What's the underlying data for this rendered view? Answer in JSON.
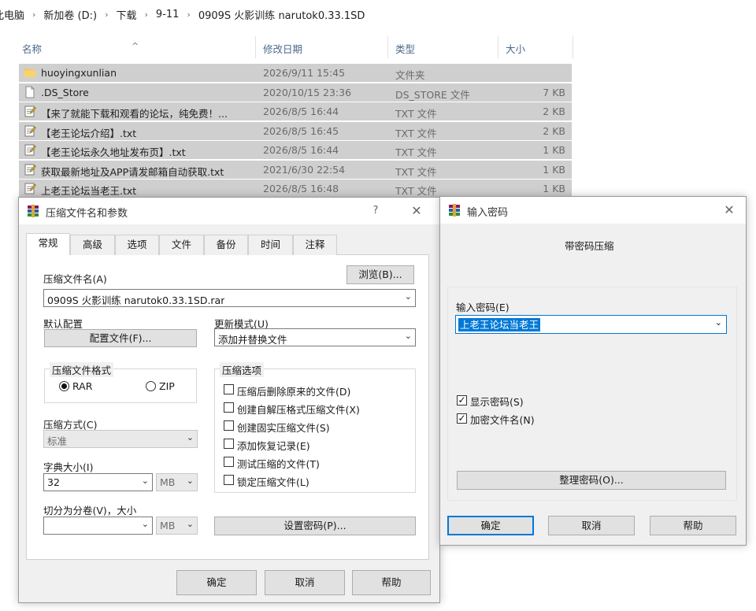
{
  "breadcrumb": [
    "此电脑",
    "新加卷 (D:)",
    "下载",
    "9-11",
    "0909S 火影训练 narutok0.33.1SD"
  ],
  "file_list": {
    "columns": {
      "name": "名称",
      "date": "修改日期",
      "type": "类型",
      "size": "大小"
    },
    "rows": [
      {
        "icon": "folder-icon",
        "name": "huoyingxunlian",
        "date": "2026/9/11 15:45",
        "type": "文件夹",
        "size": ""
      },
      {
        "icon": "file-icon",
        "name": ".DS_Store",
        "date": "2020/10/15 23:36",
        "type": "DS_STORE 文件",
        "size": "7 KB"
      },
      {
        "icon": "text-file-icon",
        "name": "【来了就能下载和观看的论坛，纯免费！...",
        "date": "2026/8/5 16:44",
        "type": "TXT 文件",
        "size": "2 KB"
      },
      {
        "icon": "text-file-icon",
        "name": "【老王论坛介绍】.txt",
        "date": "2026/8/5 16:45",
        "type": "TXT 文件",
        "size": "2 KB"
      },
      {
        "icon": "text-file-icon",
        "name": "【老王论坛永久地址发布页】.txt",
        "date": "2026/8/5 16:44",
        "type": "TXT 文件",
        "size": "1 KB"
      },
      {
        "icon": "text-file-icon",
        "name": "获取最新地址及APP请发邮箱自动获取.txt",
        "date": "2021/6/30 22:54",
        "type": "TXT 文件",
        "size": "1 KB"
      },
      {
        "icon": "text-file-icon",
        "name": "上老王论坛当老王.txt",
        "date": "2026/8/5 16:48",
        "type": "TXT 文件",
        "size": "1 KB"
      }
    ]
  },
  "archive_dialog": {
    "title": "压缩文件名和参数",
    "help_glyph": "?",
    "tabs": [
      "常规",
      "高级",
      "选项",
      "文件",
      "备份",
      "时间",
      "注释"
    ],
    "archive_name_label": "压缩文件名(A)",
    "browse_label": "浏览(B)...",
    "archive_name_value": "0909S 火影训练 narutok0.33.1SD.rar",
    "default_profile_label": "默认配置",
    "profiles_button": "配置文件(F)...",
    "update_mode_label": "更新模式(U)",
    "update_mode_value": "添加并替换文件",
    "format_group": "压缩文件格式",
    "format_rar": "RAR",
    "format_zip": "ZIP",
    "method_label": "压缩方式(C)",
    "method_value": "标准",
    "dict_label": "字典大小(I)",
    "dict_value": "32",
    "dict_unit": "MB",
    "split_label": "切分为分卷(V)，大小",
    "split_value": "",
    "split_unit": "MB",
    "options_group": "压缩选项",
    "options": [
      "压缩后删除原来的文件(D)",
      "创建自解压格式压缩文件(X)",
      "创建固实压缩文件(S)",
      "添加恢复记录(E)",
      "测试压缩的文件(T)",
      "锁定压缩文件(L)"
    ],
    "set_password_button": "设置密码(P)...",
    "ok": "确定",
    "cancel": "取消",
    "help": "帮助"
  },
  "password_dialog": {
    "title": "输入密码",
    "heading": "带密码压缩",
    "enter_label": "输入密码(E)",
    "password_value": "上老王论坛当老王",
    "show_password": "显示密码(S)",
    "encrypt_names": "加密文件名(N)",
    "organize_button": "整理密码(O)...",
    "ok": "确定",
    "cancel": "取消",
    "help": "帮助"
  }
}
